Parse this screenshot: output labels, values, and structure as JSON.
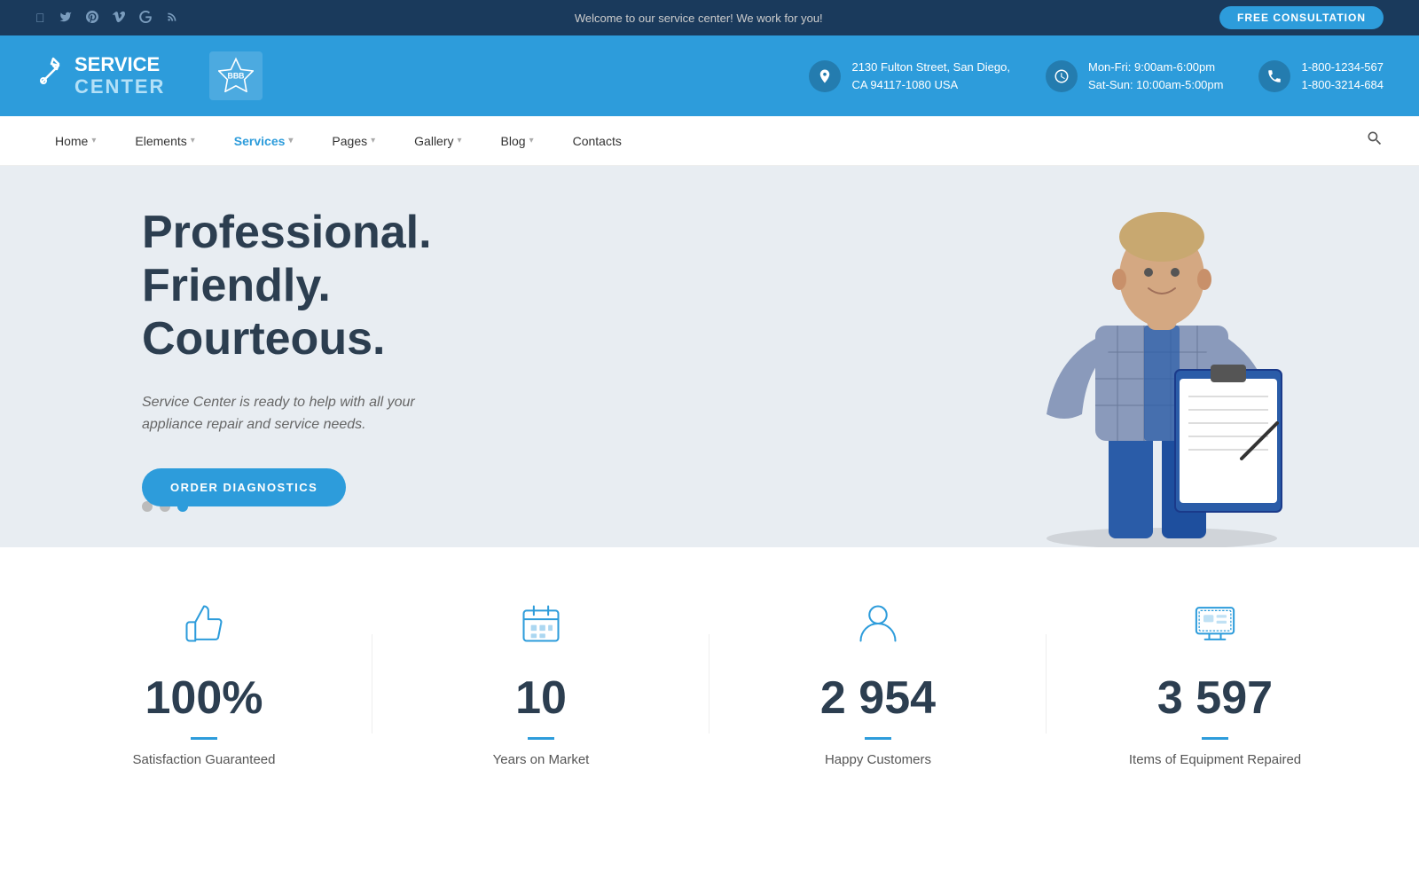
{
  "topbar": {
    "welcome_text": "Welcome to our service center! We work for you!",
    "cta_button": "FREE CONSULTATION",
    "social_icons": [
      "f",
      "t",
      "p",
      "v",
      "g",
      "rss"
    ]
  },
  "header": {
    "logo": {
      "service": "SERVICE",
      "center": "CENTER",
      "icon": "🔧"
    },
    "bbb": "BBB",
    "address": {
      "line1": "2130 Fulton Street, San Diego,",
      "line2": "CA 94117-1080 USA"
    },
    "hours": {
      "line1": "Mon-Fri: 9:00am-6:00pm",
      "line2": "Sat-Sun: 10:00am-5:00pm"
    },
    "phone": {
      "line1": "1-800-1234-567",
      "line2": "1-800-3214-684"
    }
  },
  "nav": {
    "items": [
      {
        "label": "Home",
        "has_arrow": true,
        "active": false
      },
      {
        "label": "Elements",
        "has_arrow": true,
        "active": false
      },
      {
        "label": "Services",
        "has_arrow": true,
        "active": true
      },
      {
        "label": "Pages",
        "has_arrow": true,
        "active": false
      },
      {
        "label": "Gallery",
        "has_arrow": true,
        "active": false
      },
      {
        "label": "Blog",
        "has_arrow": true,
        "active": false
      },
      {
        "label": "Contacts",
        "has_arrow": false,
        "active": false
      }
    ]
  },
  "hero": {
    "title_line1": "Professional. Friendly.",
    "title_line2": "Courteous.",
    "subtitle": "Service Center is ready to help with all your appliance repair and service needs.",
    "cta_button": "ORDER DIAGNOSTICS",
    "dots": [
      1,
      2,
      3
    ],
    "active_dot": 3
  },
  "stats": [
    {
      "icon_name": "thumbs-up-icon",
      "number": "100%",
      "label": "Satisfaction Guaranteed"
    },
    {
      "icon_name": "calendar-icon",
      "number": "10",
      "label": "Years on Market"
    },
    {
      "icon_name": "person-icon",
      "number": "2 954",
      "label": "Happy Customers"
    },
    {
      "icon_name": "monitor-icon",
      "number": "3 597",
      "label": "Items of Equipment Repaired"
    }
  ],
  "colors": {
    "primary": "#2d9cdb",
    "dark": "#2c3e50",
    "topbar_bg": "#1a3a5c"
  }
}
